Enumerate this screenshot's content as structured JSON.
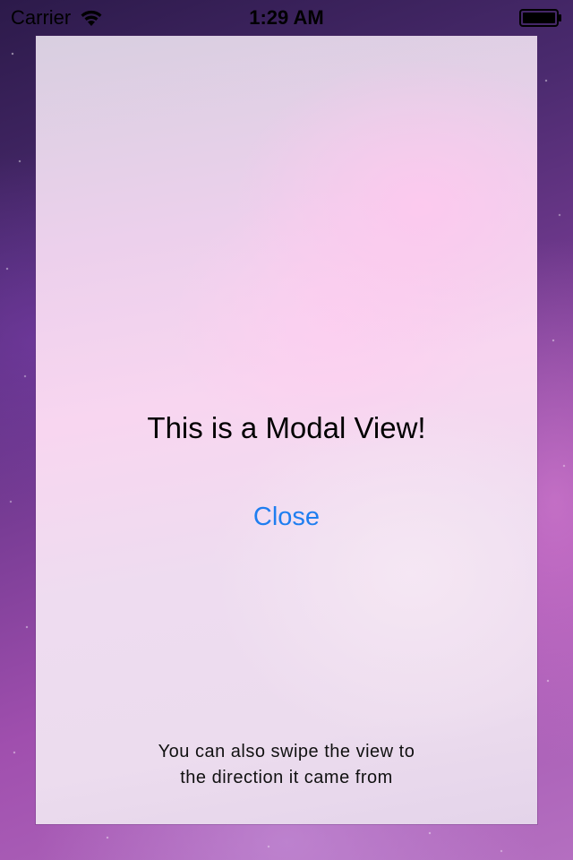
{
  "status_bar": {
    "carrier": "Carrier",
    "time": "1:29 AM",
    "wifi_icon": "wifi-icon",
    "battery_icon": "battery-icon",
    "battery_level": 1.0
  },
  "modal": {
    "title": "This is a Modal View!",
    "close_label": "Close",
    "hint_line1": "You can also swipe the view to",
    "hint_line2": "the direction it came from"
  },
  "colors": {
    "accent": "#1f7ef0",
    "text": "#000000"
  }
}
